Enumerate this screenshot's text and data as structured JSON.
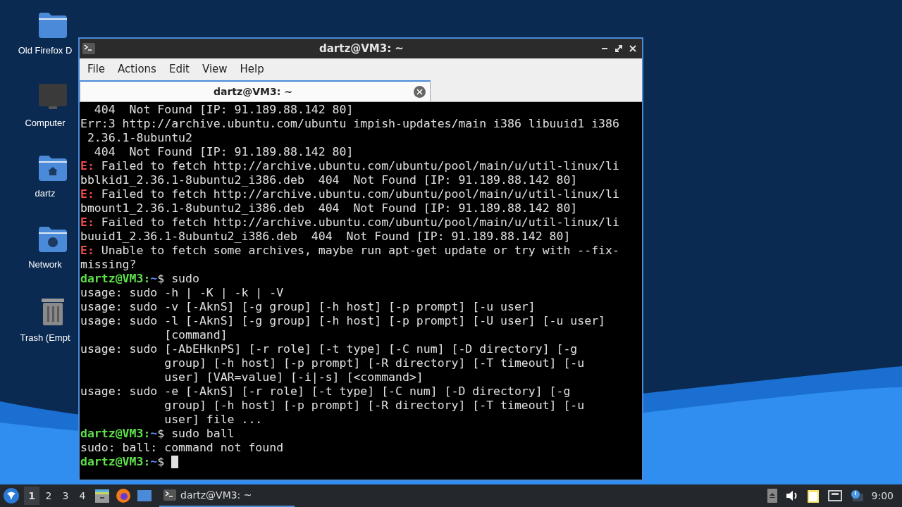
{
  "desktop_icons": [
    {
      "kind": "folder",
      "label": "Old Firefox D"
    },
    {
      "kind": "computer",
      "label": "Computer"
    },
    {
      "kind": "home",
      "label": "dartz"
    },
    {
      "kind": "network",
      "label": "Network"
    },
    {
      "kind": "trash",
      "label": "Trash (Empt"
    }
  ],
  "window": {
    "title": "dartz@VM3: ~",
    "menu": [
      "File",
      "Actions",
      "Edit",
      "View",
      "Help"
    ],
    "tabs": [
      {
        "label": "dartz@VM3: ~",
        "selected": true
      }
    ],
    "terminal": [
      {
        "kind": "plain",
        "text": "  404  Not Found [IP: 91.189.88.142 80]"
      },
      {
        "kind": "plain",
        "text": "Err:3 http://archive.ubuntu.com/ubuntu impish-updates/main i386 libuuid1 i386"
      },
      {
        "kind": "plain",
        "text": " 2.36.1-8ubuntu2"
      },
      {
        "kind": "plain",
        "text": "  404  Not Found [IP: 91.189.88.142 80]"
      },
      {
        "kind": "error",
        "prefix": "E:",
        "text": " Failed to fetch http://archive.ubuntu.com/ubuntu/pool/main/u/util-linux/li"
      },
      {
        "kind": "plain",
        "text": "bblkid1_2.36.1-8ubuntu2_i386.deb  404  Not Found [IP: 91.189.88.142 80]"
      },
      {
        "kind": "error",
        "prefix": "E:",
        "text": " Failed to fetch http://archive.ubuntu.com/ubuntu/pool/main/u/util-linux/li"
      },
      {
        "kind": "plain",
        "text": "bmount1_2.36.1-8ubuntu2_i386.deb  404  Not Found [IP: 91.189.88.142 80]"
      },
      {
        "kind": "error",
        "prefix": "E:",
        "text": " Failed to fetch http://archive.ubuntu.com/ubuntu/pool/main/u/util-linux/li"
      },
      {
        "kind": "plain",
        "text": "buuid1_2.36.1-8ubuntu2_i386.deb  404  Not Found [IP: 91.189.88.142 80]"
      },
      {
        "kind": "error",
        "prefix": "E:",
        "text": " Unable to fetch some archives, maybe run apt-get update or try with --fix-"
      },
      {
        "kind": "plain",
        "text": "missing?"
      },
      {
        "kind": "prompt",
        "user": "dartz@VM3:",
        "path": "~",
        "text": "$ sudo"
      },
      {
        "kind": "plain",
        "text": "usage: sudo -h | -K | -k | -V"
      },
      {
        "kind": "plain",
        "text": "usage: sudo -v [-AknS] [-g group] [-h host] [-p prompt] [-u user]"
      },
      {
        "kind": "plain",
        "text": "usage: sudo -l [-AknS] [-g group] [-h host] [-p prompt] [-U user] [-u user]"
      },
      {
        "kind": "plain",
        "text": "            [command]"
      },
      {
        "kind": "plain",
        "text": "usage: sudo [-AbEHknPS] [-r role] [-t type] [-C num] [-D directory] [-g"
      },
      {
        "kind": "plain",
        "text": "            group] [-h host] [-p prompt] [-R directory] [-T timeout] [-u"
      },
      {
        "kind": "plain",
        "text": "            user] [VAR=value] [-i|-s] [<command>]"
      },
      {
        "kind": "plain",
        "text": "usage: sudo -e [-AknS] [-r role] [-t type] [-C num] [-D directory] [-g"
      },
      {
        "kind": "plain",
        "text": "            group] [-h host] [-p prompt] [-R directory] [-T timeout] [-u"
      },
      {
        "kind": "plain",
        "text": "            user] file ..."
      },
      {
        "kind": "prompt",
        "user": "dartz@VM3:",
        "path": "~",
        "text": "$ sudo ball"
      },
      {
        "kind": "plain",
        "text": "sudo: ball: command not found"
      },
      {
        "kind": "prompt",
        "user": "dartz@VM3:",
        "path": "~",
        "text": "$ ",
        "cursor": true
      }
    ]
  },
  "taskbar": {
    "workspaces": [
      {
        "label": "1",
        "selected": true
      },
      {
        "label": "2",
        "selected": false
      },
      {
        "label": "3",
        "selected": false
      },
      {
        "label": "4",
        "selected": false
      }
    ],
    "tasks": [
      {
        "label": "dartz@VM3: ~",
        "selected": true
      }
    ],
    "clock": "9:00"
  }
}
